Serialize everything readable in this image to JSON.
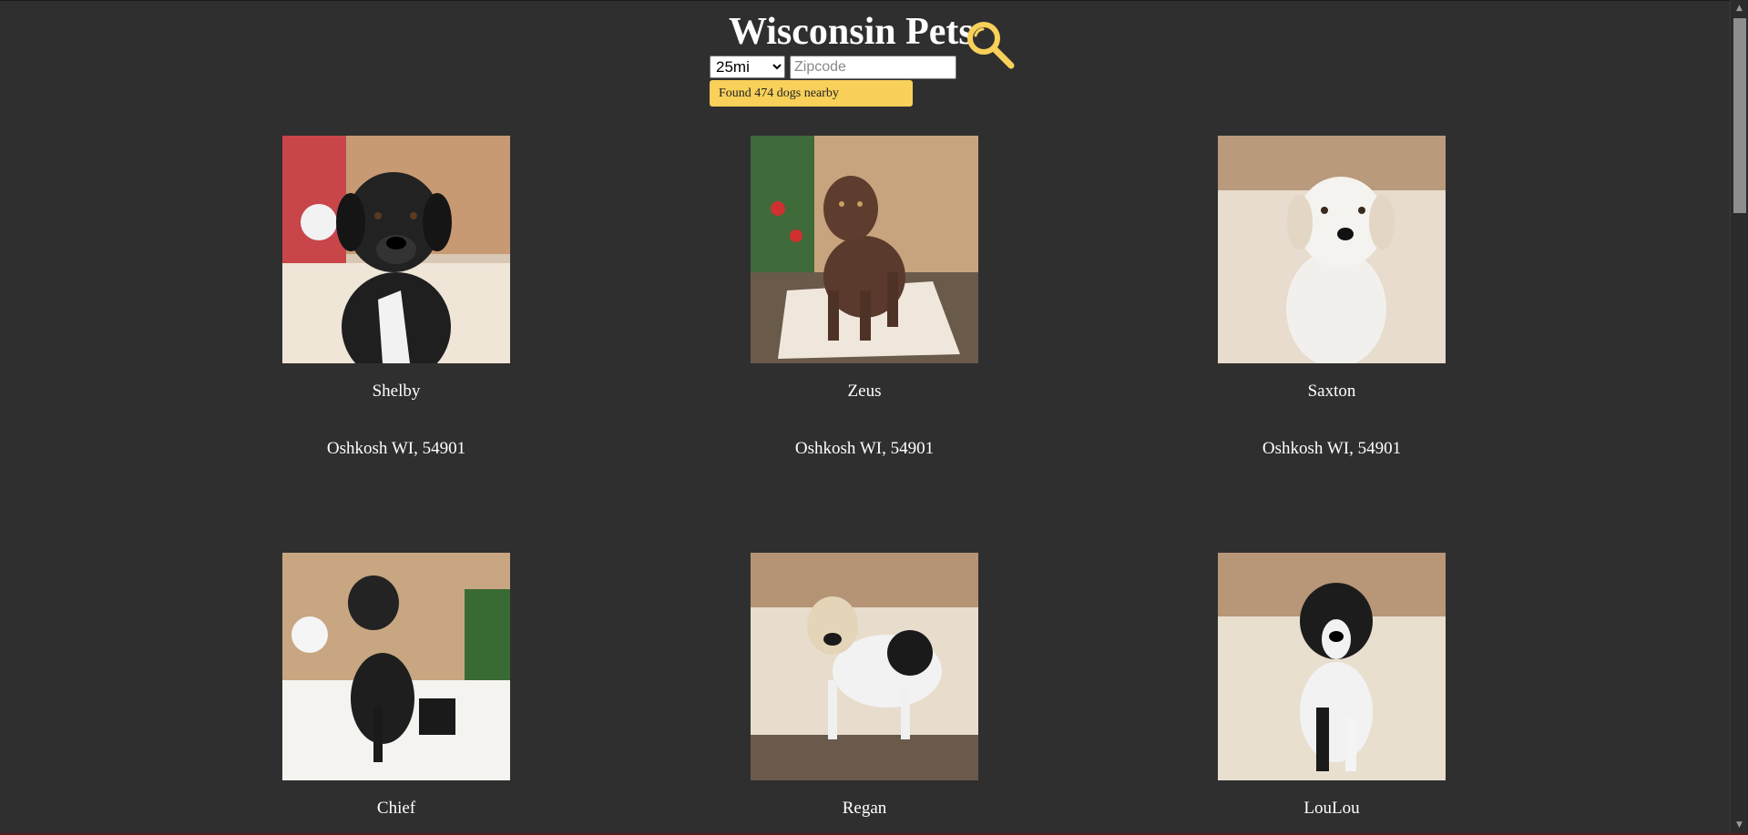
{
  "header": {
    "title": "Wisconsin Pets",
    "radius_selected": "25mi",
    "zip_placeholder": "Zipcode",
    "result_text": "Found 474 dogs nearby"
  },
  "dogs": [
    {
      "name": "Shelby",
      "location": "Oshkosh WI, 54901"
    },
    {
      "name": "Zeus",
      "location": "Oshkosh WI, 54901"
    },
    {
      "name": "Saxton",
      "location": "Oshkosh WI, 54901"
    },
    {
      "name": "Chief",
      "location": ""
    },
    {
      "name": "Regan",
      "location": ""
    },
    {
      "name": "LouLou",
      "location": ""
    }
  ],
  "colors": {
    "background": "#2f2f2f",
    "accent": "#f8d05a",
    "text": "#ffffff"
  },
  "icons": {
    "search": "magnifier-icon",
    "scroll_up": "chevron-up-icon",
    "scroll_down": "chevron-down-icon"
  }
}
